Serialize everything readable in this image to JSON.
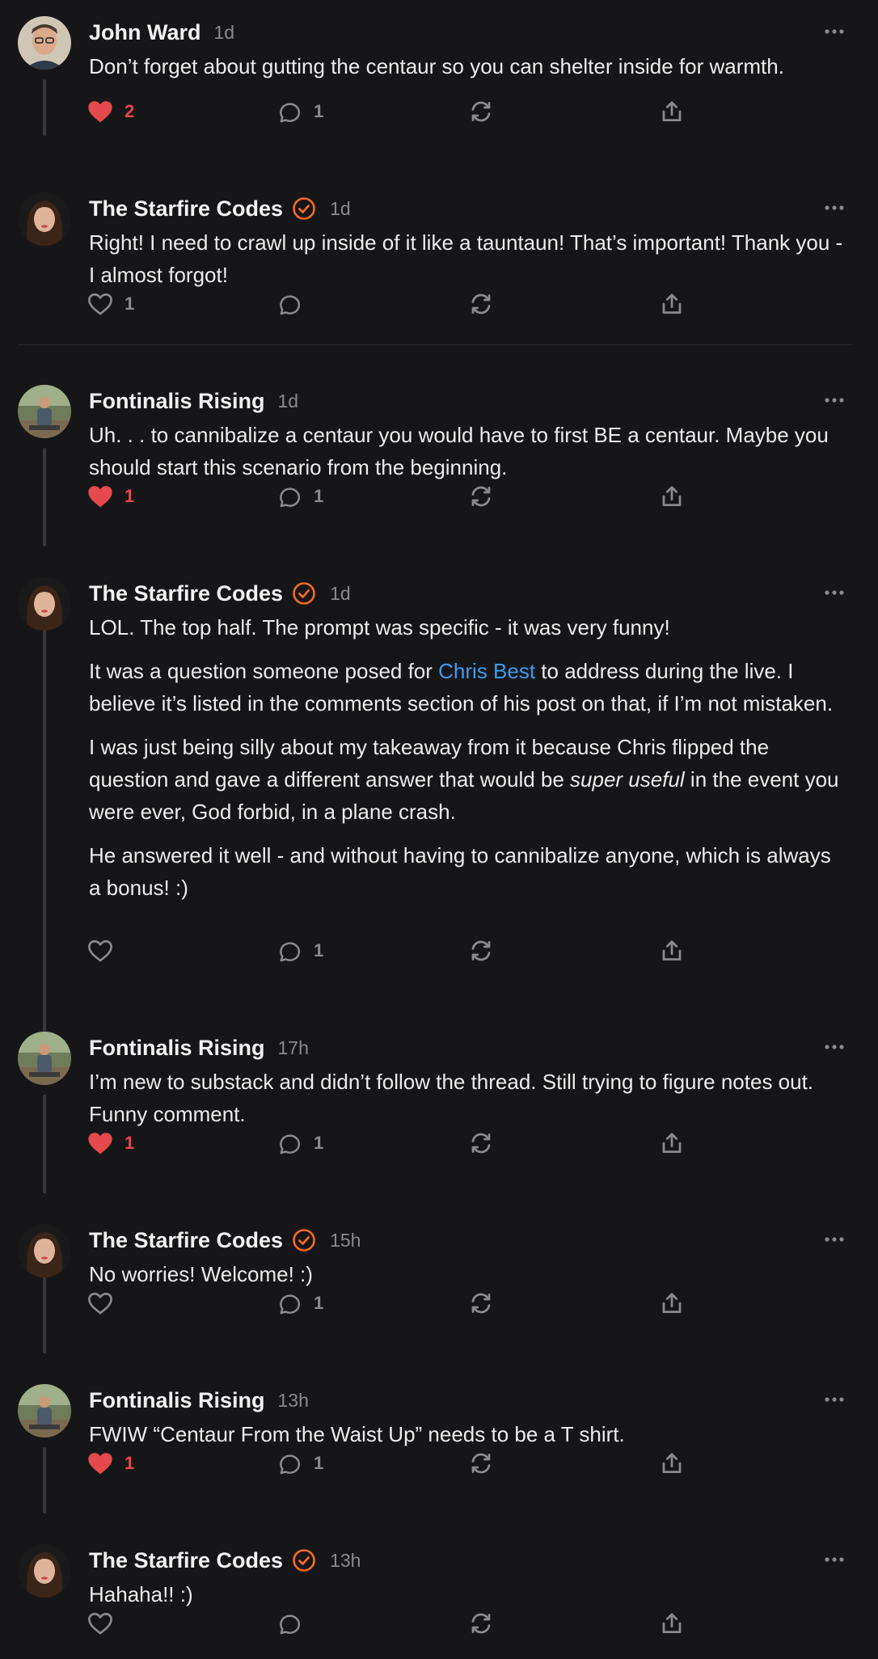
{
  "colors": {
    "background": "#161618",
    "text": "#ececec",
    "muted": "#8a8a8e",
    "like_active": "#e5484d",
    "verified": "#f26b22",
    "link": "#3d9bf0"
  },
  "icons": {
    "like": "heart-icon",
    "comment": "speech-bubble-icon",
    "restack": "refresh-arrows-icon",
    "share": "share-upload-icon",
    "more": "ellipsis-icon",
    "verified": "check-circle-icon"
  },
  "comments": [
    {
      "author": "John Ward",
      "verified": false,
      "time": "1d",
      "text": "Don’t forget about gutting the centaur so you can shelter inside for warmth.",
      "likes": "2",
      "liked": true,
      "replies": "1"
    },
    {
      "author": "The Starfire Codes",
      "verified": true,
      "time": "1d",
      "text": "Right! I need to crawl up inside of it like a tauntaun! That’s important! Thank you - I almost forgot!",
      "likes": "1",
      "liked": false,
      "replies": ""
    },
    {
      "author": "Fontinalis Rising",
      "verified": false,
      "time": "1d",
      "text": "Uh. . . to cannibalize a centaur you would have to first BE a centaur. Maybe you should start this scenario from the beginning.",
      "likes": "1",
      "liked": true,
      "replies": "1"
    },
    {
      "author": "The Starfire Codes",
      "verified": true,
      "time": "1d",
      "p1": "LOL. The top half. The prompt was specific - it was very funny!",
      "p2_before": "It was a question someone posed for ",
      "p2_link": "Chris Best",
      "p2_after": " to address during the live. I believe it’s listed in the comments section of his post on that, if I’m not mistaken.",
      "p3_before": "I was just being silly about my takeaway from it because Chris flipped the question and gave a different answer that would be ",
      "p3_em": "super useful",
      "p3_after": " in the event you were ever, God forbid, in a plane crash.",
      "p4": "He answered it well - and without having to cannibalize anyone, which is always a bonus! :)",
      "likes": "",
      "liked": false,
      "replies": "1"
    },
    {
      "author": "Fontinalis Rising",
      "verified": false,
      "time": "17h",
      "text": "I’m new to substack and didn’t follow the thread. Still trying to figure notes out. Funny comment.",
      "likes": "1",
      "liked": true,
      "replies": "1"
    },
    {
      "author": "The Starfire Codes",
      "verified": true,
      "time": "15h",
      "text": "No worries! Welcome! :)",
      "likes": "",
      "liked": false,
      "replies": "1"
    },
    {
      "author": "Fontinalis Rising",
      "verified": false,
      "time": "13h",
      "text": "FWIW “Centaur From the Waist Up” needs to be a T shirt.",
      "likes": "1",
      "liked": true,
      "replies": "1"
    },
    {
      "author": "The Starfire Codes",
      "verified": true,
      "time": "13h",
      "text": "Hahaha!! :)",
      "likes": "",
      "liked": false,
      "replies": ""
    }
  ]
}
